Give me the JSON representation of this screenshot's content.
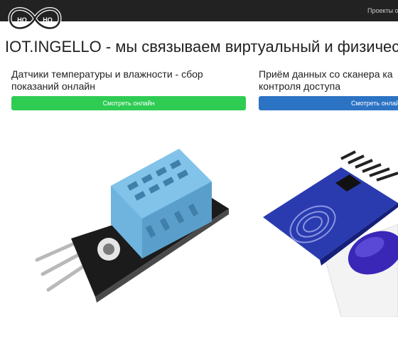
{
  "header": {
    "logo_left": "HQ",
    "logo_right": "HQ",
    "nav_link": "Проекты о"
  },
  "page": {
    "title": "IOT.INGELLO - мы связываем виртуальный и физичес"
  },
  "cards": [
    {
      "title_line1": "Датчики температуры и влажности - сбор",
      "title_line2": "показаний онлайн",
      "button": "Смотреть онлайн",
      "image_icon": "dht11-sensor-image"
    },
    {
      "title_line1": "Приём данных со сканера ка",
      "title_line2": "контроля доступа",
      "button": "Смотреть онлай",
      "image_icon": "rfid-scanner-image"
    }
  ],
  "colors": {
    "navbar": "#222222",
    "button_green": "#2ecc53",
    "button_blue": "#2c73c4"
  }
}
